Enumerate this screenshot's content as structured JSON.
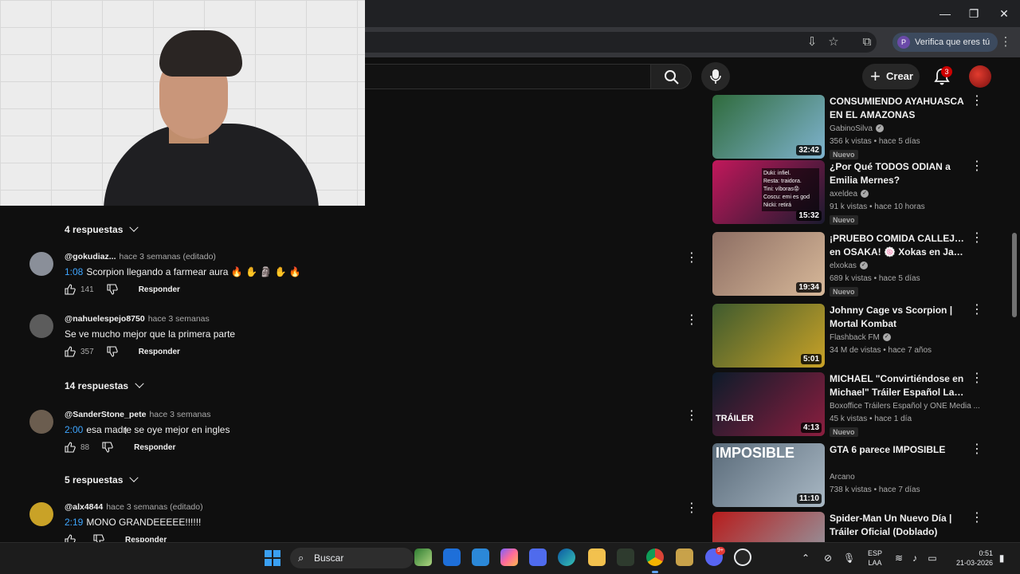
{
  "browser": {
    "profile_button": "Verifica que eres tú",
    "profile_initial": "P"
  },
  "youtube_header": {
    "create_label": "Crear",
    "notification_count": "3"
  },
  "comments": [
    {
      "type": "replies",
      "label": "4 respuestas"
    },
    {
      "type": "comment",
      "user": "@gokudiaz...",
      "time": "hace 3 semanas (editado)",
      "timestamp": "1:08",
      "text": "Scorpion llegando a farmear aura 🔥 ✋ 🗿 ✋ 🔥",
      "likes": "141",
      "reply_label": "Responder"
    },
    {
      "type": "comment",
      "user": "@nahuelespejo8750",
      "time": "hace 3 semanas",
      "timestamp": "",
      "text": "Se ve mucho mejor que la primera parte",
      "likes": "357",
      "reply_label": "Responder"
    },
    {
      "type": "replies",
      "label": "14 respuestas"
    },
    {
      "type": "comment",
      "user": "@SanderStone_pete",
      "time": "hace 3 semanas",
      "timestamp": "2:00",
      "text": "esa madre se oye mejor en ingles",
      "likes": "88",
      "reply_label": "Responder"
    },
    {
      "type": "replies",
      "label": "5 respuestas"
    },
    {
      "type": "comment",
      "user": "@alx4844",
      "time": "hace 3 semanas (editado)",
      "timestamp": "2:19",
      "text": "MONO GRANDEEEEE!!!!!!",
      "likes": "",
      "reply_label": "Responder"
    }
  ],
  "sidebar_videos": [
    {
      "title1": "CONSUMIENDO AYAHUASCA",
      "title2": "EN EL AMAZONAS",
      "channel": "GabinoSilva",
      "verified": true,
      "meta": "356 k vistas • hace 5 días",
      "badge": "Nuevo",
      "duration": "32:42",
      "thumb_colors": [
        "#2f6b3c",
        "#7fb3cf"
      ]
    },
    {
      "title1": "¿Por Qué TODOS ODIAN a",
      "title2": "Emilia Mernes?",
      "channel": "axeldea",
      "verified": true,
      "meta": "91 k vistas • hace 10 horas",
      "badge": "Nuevo",
      "duration": "15:32",
      "thumb_colors": [
        "#c2185b",
        "#1a1a2e"
      ],
      "thumb_lines": [
        "Duki: infiel.",
        "Resta: traidora.",
        "Tini: víboras😡",
        "Coscu: emi es god",
        "Nicki: retirá"
      ]
    },
    {
      "title1": "¡PRUEBO COMIDA CALLEJERA",
      "title2": "en OSAKA! 🍥 Xokas en Japón",
      "channel": "elxokas",
      "verified": true,
      "meta": "689 k vistas • hace 5 días",
      "badge": "Nuevo",
      "duration": "19:34",
      "thumb_colors": [
        "#8d6e63",
        "#d7b899"
      ]
    },
    {
      "title1": "Johnny Cage vs Scorpion |",
      "title2": "Mortal Kombat",
      "channel": "Flashback FM",
      "verified": true,
      "meta": "34 M de vistas • hace 7 años",
      "badge": "",
      "duration": "5:01",
      "thumb_colors": [
        "#3e5a2e",
        "#c9a227"
      ]
    },
    {
      "title1": "MICHAEL \"Convirtiéndose en",
      "title2": "Michael\" Tráiler Español Latin...",
      "channel": "Boxoffice Tráilers Español y ONE Media ...",
      "verified": false,
      "meta": "45 k vistas • hace 1 día",
      "badge": "Nuevo",
      "duration": "4:13",
      "thumb_colors": [
        "#0d1b2a",
        "#8b1e3f"
      ],
      "thumb_text": "TRÁILER"
    },
    {
      "title1": "GTA 6 parece IMPOSIBLE",
      "title2": "",
      "channel": "Arcano",
      "verified": false,
      "meta": "738 k vistas • hace 7 días",
      "badge": "",
      "duration": "11:10",
      "thumb_colors": [
        "#5a6b7a",
        "#a9b8c4"
      ],
      "thumb_text": "IMPOSIBLE"
    },
    {
      "title1": "Spider-Man Un Nuevo Día |",
      "title2": "Tráiler Oficial (Doblado)",
      "channel": "",
      "verified": false,
      "meta": "",
      "badge": "",
      "duration": "",
      "thumb_colors": [
        "#b71c1c",
        "#90a4ae"
      ]
    }
  ],
  "taskbar": {
    "search_label": "Buscar",
    "lang_line1": "ESP",
    "lang_line2": "LAA",
    "time": "0:51",
    "date": "21-03-2026",
    "discord_badge": "9+"
  }
}
